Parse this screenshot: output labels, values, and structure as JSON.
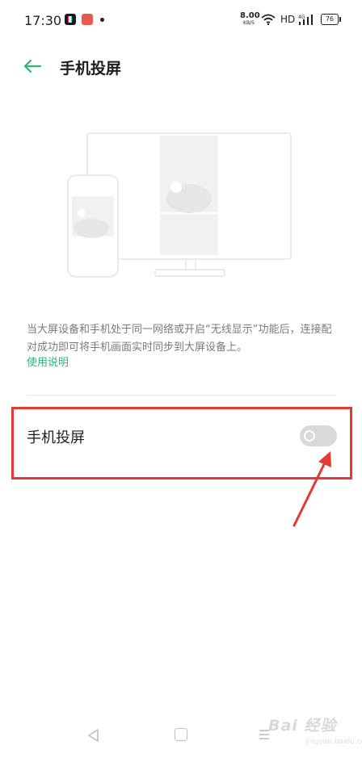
{
  "status_bar": {
    "time": "17:30",
    "net_speed_value": "8.00",
    "net_speed_unit": "KB/S",
    "hd_label": "HD",
    "battery_level": "76",
    "icons": [
      "tiktok-icon",
      "red-app-icon",
      "notification-dot",
      "wifi-icon",
      "signal-icon",
      "battery-icon"
    ]
  },
  "header": {
    "title": "手机投屏",
    "back_icon": "arrow-left-icon"
  },
  "colors": {
    "accent": "#2bb673",
    "annotation": "#e53935",
    "toggle_off": "#d9d9d9"
  },
  "illustration": {
    "icon": "phone-and-monitor-illustration"
  },
  "description": {
    "text": "当大屏设备和手机处于同一网络或开启“无线显示”功能后，连接配对成功即可将手机画面实时同步到大屏设备上。",
    "help_link": "使用说明"
  },
  "settings": {
    "screen_cast_label": "手机投屏",
    "screen_cast_enabled": false
  },
  "nav_bar": {
    "icons": [
      "back-triangle-icon",
      "home-square-icon",
      "menu-icon"
    ]
  },
  "watermark": {
    "text": "Bai 经验",
    "sub_text": "jingyan.baidu.com"
  }
}
